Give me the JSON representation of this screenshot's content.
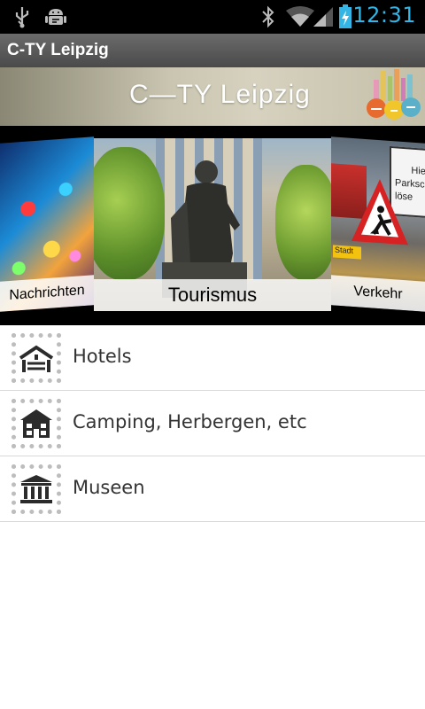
{
  "status_bar": {
    "time": "12:31"
  },
  "app": {
    "title": "C-TY Leipzig"
  },
  "banner": {
    "logo_text": "C—TY Leipzig"
  },
  "carousel": {
    "left_label": "Nachrichten",
    "center_label": "Tourismus",
    "right_label": "Verkehr",
    "right_sign_text": "Hier\nParksc\nlöse",
    "right_sub_text": "Stadt"
  },
  "list": {
    "items": [
      {
        "label": "Hotels",
        "icon": "hotel-icon"
      },
      {
        "label": "Camping, Herbergen, etc",
        "icon": "building-icon"
      },
      {
        "label": "Museen",
        "icon": "museum-icon"
      }
    ]
  },
  "colors": {
    "clock": "#33b5e5",
    "accent": "#33b5e5"
  }
}
